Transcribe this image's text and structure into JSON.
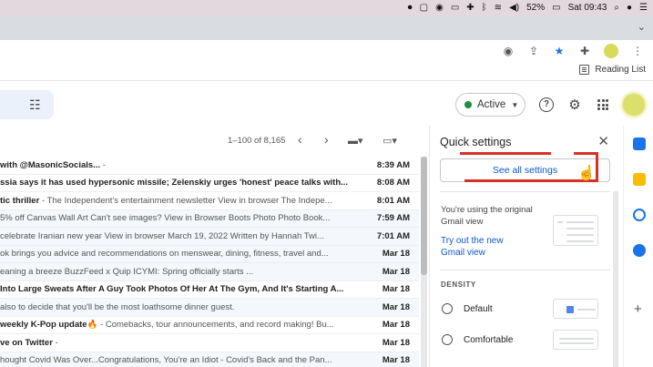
{
  "menubar": {
    "battery": "52%",
    "clock": "Sat 09:43",
    "icons": [
      "record-icon",
      "screen-mirror-icon",
      "eye-icon",
      "airplay-icon",
      "flag-uk-icon",
      "bluetooth-icon",
      "wifi-icon",
      "volume-icon",
      "battery-icon",
      "spotlight-icon",
      "siri-icon",
      "control-center-icon"
    ]
  },
  "browser": {
    "reading_list": "Reading List",
    "toolbar_icons": [
      "eye-icon",
      "share-icon",
      "star-icon",
      "extensions-icon",
      "profile-avatar",
      "more-icon"
    ]
  },
  "gmail": {
    "status": "Active",
    "pager": "1–100 of 8,165"
  },
  "emails": [
    {
      "subject": "with @MasonicSocials...",
      "snippet": " -",
      "date": "8:39 AM",
      "unread": true
    },
    {
      "subject": "ssia says it has used hypersonic missile; Zelenskiy urges 'honest' peace talks with...",
      "snippet": "",
      "date": "8:08 AM",
      "unread": true
    },
    {
      "subject": "tic thriller",
      "snippet": " - The Independent's entertainment newsletter View in browser The Indepe...",
      "date": "8:01 AM",
      "unread": true
    },
    {
      "subject": "",
      "snippet": "5% off Canvas Wall Art Can't see images? View in Browser Boots Photo Photo Book...",
      "date": "7:59 AM",
      "unread": false
    },
    {
      "subject": "",
      "snippet": "celebrate Iranian new year View in browser March 19, 2022 Written by Hannah Twi...",
      "date": "7:01 AM",
      "unread": false
    },
    {
      "subject": "",
      "snippet": "ok brings you advice and recommendations on menswear, dining, fitness, travel and...",
      "date": "Mar 18",
      "unread": false
    },
    {
      "subject": "",
      "snippet": "eaning a breeze BuzzFeed x Quip ICYMI: Spring officially starts ...",
      "date": "Mar 18",
      "unread": false
    },
    {
      "subject": " Into Large Sweats After A Guy Took Photos Of Her At The Gym, And It's Starting A...",
      "snippet": "",
      "date": "Mar 18",
      "unread": true
    },
    {
      "subject": "",
      "snippet": "also to decide that you'll be the most loathsome dinner guest.",
      "date": "Mar 18",
      "unread": false
    },
    {
      "subject": " weekly K-Pop update🔥",
      "snippet": " - Comebacks, tour announcements, and record making! Bu...",
      "date": "Mar 18",
      "unread": true
    },
    {
      "subject": "ve on Twitter",
      "snippet": " -",
      "date": "Mar 18",
      "unread": true
    },
    {
      "subject": "",
      "snippet": "hought Covid Was Over...Congratulations, You're an Idiot - Covid's Back and the Pan...",
      "date": "Mar 18",
      "unread": false
    }
  ],
  "quick_settings": {
    "title": "Quick settings",
    "see_all": "See all settings",
    "using_text": "You're using the original Gmail view",
    "try_link": "Try out the new Gmail view",
    "density_label": "DENSITY",
    "density_options": [
      "Default",
      "Comfortable"
    ]
  },
  "colors": {
    "accent": "#0b57d0",
    "active_status": "#1e8e3e",
    "annotation_red": "#d93025"
  }
}
